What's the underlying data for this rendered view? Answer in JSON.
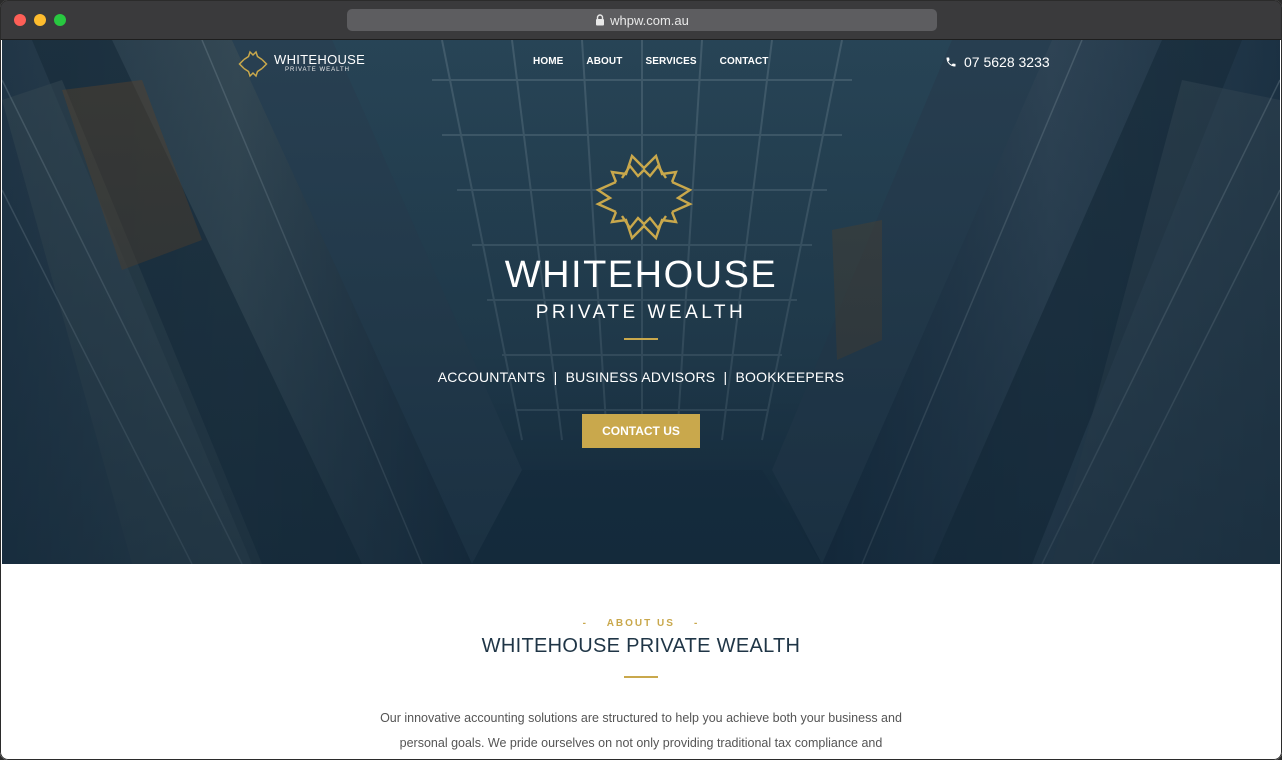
{
  "browser": {
    "url": "whpw.com.au"
  },
  "header": {
    "logo_title": "WHITEHOUSE",
    "logo_subtitle": "PRIVATE WEALTH",
    "nav": [
      "HOME",
      "ABOUT",
      "SERVICES",
      "CONTACT"
    ],
    "phone": "07 5628 3233"
  },
  "hero": {
    "title": "WHITEHOUSE",
    "subtitle": "PRIVATE WEALTH",
    "tagline": "ACCOUNTANTS  |  BUSINESS ADVISORS  |  BOOKKEEPERS",
    "cta_label": "CONTACT US"
  },
  "about": {
    "eyebrow": "-    ABOUT US    -",
    "title": "WHITEHOUSE PRIVATE WEALTH",
    "text_line1": "Our innovative accounting solutions are structured to help you achieve both your business and",
    "text_line2": "personal goals. We pride ourselves on not only providing traditional tax compliance and"
  },
  "colors": {
    "accent_gold": "#c9a84c",
    "hero_navy": "#1c3447",
    "heading_navy": "#1f3546"
  },
  "icons": [
    "lock-icon",
    "phone-icon",
    "logo-mark-icon"
  ]
}
